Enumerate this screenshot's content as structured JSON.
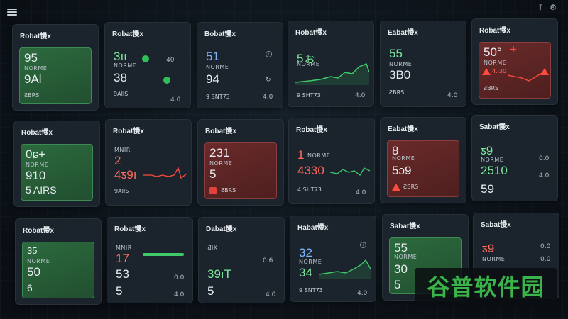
{
  "topbar": {
    "right_icons": [
      "pin-icon",
      "settings-icon"
    ]
  },
  "cards": [
    {
      "title": "Robat慢x",
      "theme": "green",
      "lines": [
        "95",
        "NORME",
        "9Al",
        "ƧBRS"
      ]
    },
    {
      "title": "Robat慢x",
      "theme": "plain",
      "lines": [
        "3ıı",
        "NORME",
        "38",
        "9AIIS"
      ],
      "right": [
        "4.0",
        "40"
      ]
    },
    {
      "title": "Bobat慢x",
      "theme": "plain",
      "lines": [
        "51",
        "NORME",
        "94",
        "9 SNT73"
      ],
      "right": [
        "",
        "4.0"
      ]
    },
    {
      "title": "Robat慢x",
      "theme": "plain",
      "lines": [
        "5ぉ",
        "NORME",
        "",
        "9 SHT73"
      ],
      "right": [
        "",
        "4.0"
      ]
    },
    {
      "title": "Eabat慢x",
      "theme": "plain",
      "lines": [
        "55",
        "NORME",
        "3B0",
        "ƧBRS"
      ],
      "right": [
        "",
        "4.0"
      ]
    },
    {
      "title": "Robat慢x",
      "theme": "red",
      "lines": [
        "50°",
        "NORME",
        "4.ı30",
        "ƧBRS"
      ]
    },
    {
      "title": "Robat慢x",
      "theme": "green",
      "lines": [
        "0ɕ+",
        "NORME",
        "910",
        "5 AIRS"
      ]
    },
    {
      "title": "Robat慢x",
      "theme": "plain",
      "lines": [
        "MNIR",
        "2",
        "4ƽ9ı",
        "9AIIS"
      ]
    },
    {
      "title": "Bobat慢x",
      "theme": "red",
      "lines": [
        "231",
        "NORME",
        "5",
        "ƧBRS"
      ]
    },
    {
      "title": "Robat慢x",
      "theme": "plain",
      "lines": [
        "1",
        "NORME",
        "4330",
        "4 SHT73"
      ],
      "right": [
        "",
        "4.0"
      ]
    },
    {
      "title": "Eabat慢x",
      "theme": "red",
      "lines": [
        "8",
        "NORME",
        "5ɔ9",
        "ƧBRS"
      ]
    },
    {
      "title": "Sabat慢x",
      "theme": "plain",
      "lines": [
        "ƽ9",
        "NORME",
        "2510",
        "59"
      ],
      "right": [
        "0.0",
        "4.0"
      ]
    },
    {
      "title": "Robat慢x",
      "theme": "green",
      "lines": [
        "35",
        "NORME",
        "50",
        "6"
      ]
    },
    {
      "title": "Robat慢x",
      "theme": "plain",
      "lines": [
        "MNIR",
        "17",
        "53",
        "5"
      ],
      "right": [
        "0.0",
        "4.0"
      ]
    },
    {
      "title": "Dabat慢x",
      "theme": "plain",
      "lines": [
        "ƋIK",
        "",
        "39ıT",
        "5"
      ],
      "right": [
        "0.6",
        "4.0"
      ]
    },
    {
      "title": "Habat慢x",
      "theme": "plain",
      "lines": [
        "32",
        "NORME",
        "34",
        "9 SNT73"
      ],
      "right": [
        "",
        "4.0"
      ]
    },
    {
      "title": "Sabat慢x",
      "theme": "green",
      "lines": [
        "55",
        "NORME",
        "30",
        "5"
      ]
    },
    {
      "title": "Sabat慢x",
      "theme": "plain",
      "lines": [
        "ƽ9",
        "NORME",
        "",
        "6"
      ],
      "right": [
        "0.0",
        "0.0"
      ]
    }
  ],
  "watermark": "谷普软件园",
  "colors": {
    "accent_green": "#3ec96a",
    "alert_red": "#ff4a3e",
    "text_primary": "#e8eef2"
  }
}
